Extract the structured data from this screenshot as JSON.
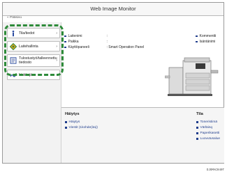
{
  "window": {
    "title": "Web Image Monitor"
  },
  "breadcrumb": {
    "label": "Pääsivu"
  },
  "sidebar": {
    "items": [
      {
        "label": "Tila/tiedot",
        "icon": "info-icon",
        "has_submenu": true
      },
      {
        "label": "Laitehallinta",
        "icon": "device-management-icon",
        "has_submenu": true
      },
      {
        "label": "Tulostustyö/talleennettu tiedosto",
        "icon": "print-job-icon",
        "has_submenu": true
      },
      {
        "label": "Linkkejä",
        "icon": "link-icon",
        "has_submenu": false
      }
    ]
  },
  "device_info": {
    "rows": [
      {
        "key": "Laitenimi",
        "value": ":"
      },
      {
        "key": "Paikka",
        "value": ":"
      },
      {
        "key": "Käyttöpaneeli",
        "value": ": Smart Operation Panel"
      }
    ],
    "links": [
      "Kommentti",
      "Isäntänimi"
    ]
  },
  "alerts": {
    "title": "Häiytys",
    "items": [
      "Häiytys",
      "Viestit (1kohde(ita))"
    ]
  },
  "status": {
    "title": "Tila",
    "items": [
      "Toneristimä",
      "Värläinq",
      "Paperikasetti",
      "Luovutusalue"
    ]
  },
  "footer": {
    "code": "DJOMAC040T"
  },
  "colors": {
    "accent_green": "#2e8b3a",
    "link_blue": "#1f3d8c"
  }
}
